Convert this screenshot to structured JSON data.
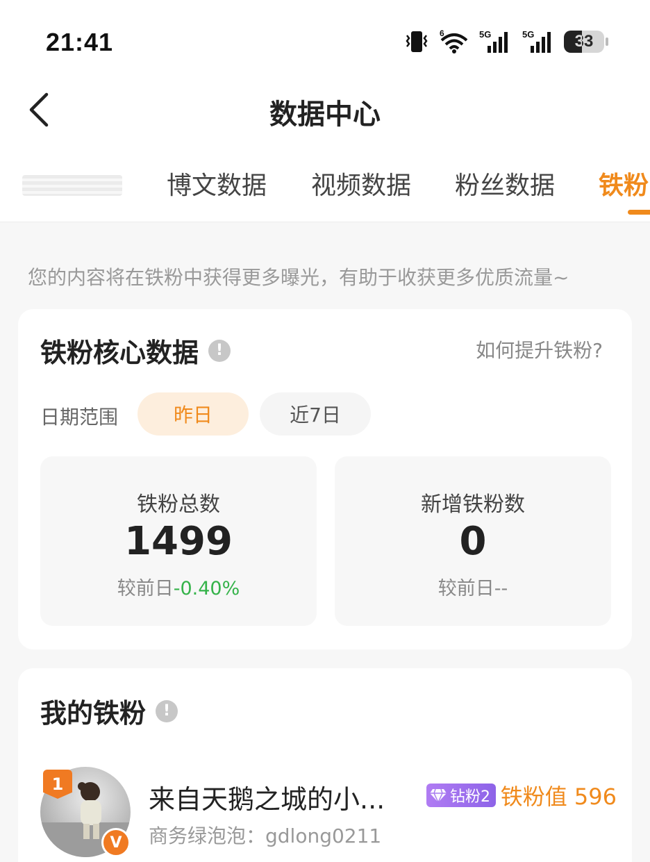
{
  "status_bar": {
    "time": "21:41",
    "battery_level": "33",
    "network_1": "5G",
    "network_2": "5G",
    "wifi_label": "6"
  },
  "header": {
    "title": "数据中心"
  },
  "tabs": [
    {
      "label": "博文数据",
      "active": false
    },
    {
      "label": "视频数据",
      "active": false
    },
    {
      "label": "粉丝数据",
      "active": false
    },
    {
      "label": "铁粉",
      "active": true
    }
  ],
  "hint": "您的内容将在铁粉中获得更多曝光，有助于收获更多优质流量~",
  "core": {
    "title": "铁粉核心数据",
    "howto_link": "如何提升铁粉?",
    "range_label": "日期范围",
    "range_options": [
      "昨日",
      "近7日"
    ],
    "selected_range": "昨日",
    "stats": [
      {
        "label": "铁粉总数",
        "value": "1499",
        "compare_prefix": "较前日",
        "delta": "-0.40%"
      },
      {
        "label": "新增铁粉数",
        "value": "0",
        "compare_prefix": "较前日",
        "delta": "--"
      }
    ]
  },
  "my_fans": {
    "title": "我的铁粉",
    "list": [
      {
        "rank": "1",
        "name": "来自天鹅之城的小...",
        "subtitle": "商务绿泡泡：gdlong0211",
        "level": "钻粉2",
        "score_label": "铁粉值 596",
        "verified_badge": "V"
      }
    ]
  },
  "colors": {
    "accent": "#f08a1c",
    "positive": "#35b34a",
    "level_badge": "#9a6cf0"
  }
}
